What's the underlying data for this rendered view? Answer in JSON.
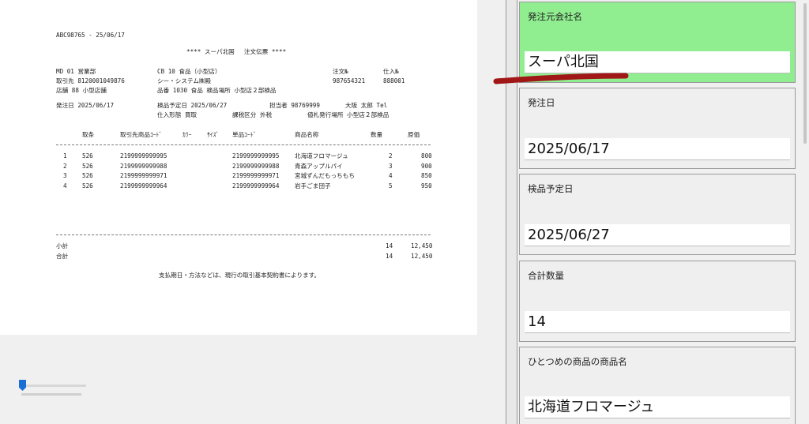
{
  "document": {
    "header_id": "ABC98765 - 25/06/17",
    "title": "**** スーパ北国　 注文伝票 ****",
    "rows": [
      {
        "c1": "MD 01 営業部",
        "c2": "CB  10  食品（小型店）",
        "c3": "注文№",
        "c4": "仕入№"
      },
      {
        "c1": "取引先     8120001049876",
        "c2": "シー・システム㈱殿",
        "c3": "987654321",
        "c4": "888001"
      },
      {
        "c1": "店舗       88  小型店舗",
        "c2": "品番  1030  食品      検品場所  小型店２部検品"
      }
    ],
    "line_order": "発注日  2025/06/17",
    "line_inspect": "検品予定日  2025/06/27",
    "line_staff": "担当者  98769999",
    "line_name": "大阪  太郎  Tel",
    "line_form": "仕入形態  買取",
    "line_tax": "課税区分  外税",
    "line_tag": "値札発行場所  小型店２部検品",
    "columns": [
      "取条",
      "取引先商品ｺｰﾄﾞ",
      "ｶﾗｰ",
      "ｻｲｽﾞ",
      "単品ｺｰﾄﾞ",
      "商品名称",
      "数量",
      "原価"
    ],
    "items": [
      {
        "no": "1",
        "cond": "526",
        "supplier_code": "2199999999995",
        "sku": "2199999999995",
        "name": "北海道フロマージュ",
        "qty": "2",
        "cost": "800"
      },
      {
        "no": "2",
        "cond": "526",
        "supplier_code": "2199999999988",
        "sku": "2199999999988",
        "name": "青森アップルパイ",
        "qty": "3",
        "cost": "900"
      },
      {
        "no": "3",
        "cond": "526",
        "supplier_code": "2199999999971",
        "sku": "2199999999971",
        "name": "宮城ずんだもっちもち",
        "qty": "4",
        "cost": "850"
      },
      {
        "no": "4",
        "cond": "526",
        "supplier_code": "2199999999964",
        "sku": "2199999999964",
        "name": "岩手ごま団子",
        "qty": "5",
        "cost": "950"
      }
    ],
    "subtotal_label": "小計",
    "subtotal_qty": "14",
    "subtotal_cost": "12,450",
    "total_label": "合計",
    "total_qty": "14",
    "total_cost": "12,450",
    "footer_note": "支払期日・方法などは、現行の取引基本契約書によります。"
  },
  "zoom_slider": {
    "value": 0.05
  },
  "form": {
    "fields": [
      {
        "label": "発注元会社名",
        "value": "スーパ北国",
        "active": true
      },
      {
        "label": "発注日",
        "value": "2025/06/17",
        "active": false
      },
      {
        "label": "検品予定日",
        "value": "2025/06/27",
        "active": false
      },
      {
        "label": "合計数量",
        "value": "14",
        "active": false
      },
      {
        "label": "ひとつめの商品の商品名",
        "value": "北海道フロマージュ",
        "active": false
      }
    ]
  },
  "colors": {
    "active_field": "#90ee90",
    "annotation_stroke": "#a11616",
    "slider_thumb": "#1a6fd6"
  }
}
